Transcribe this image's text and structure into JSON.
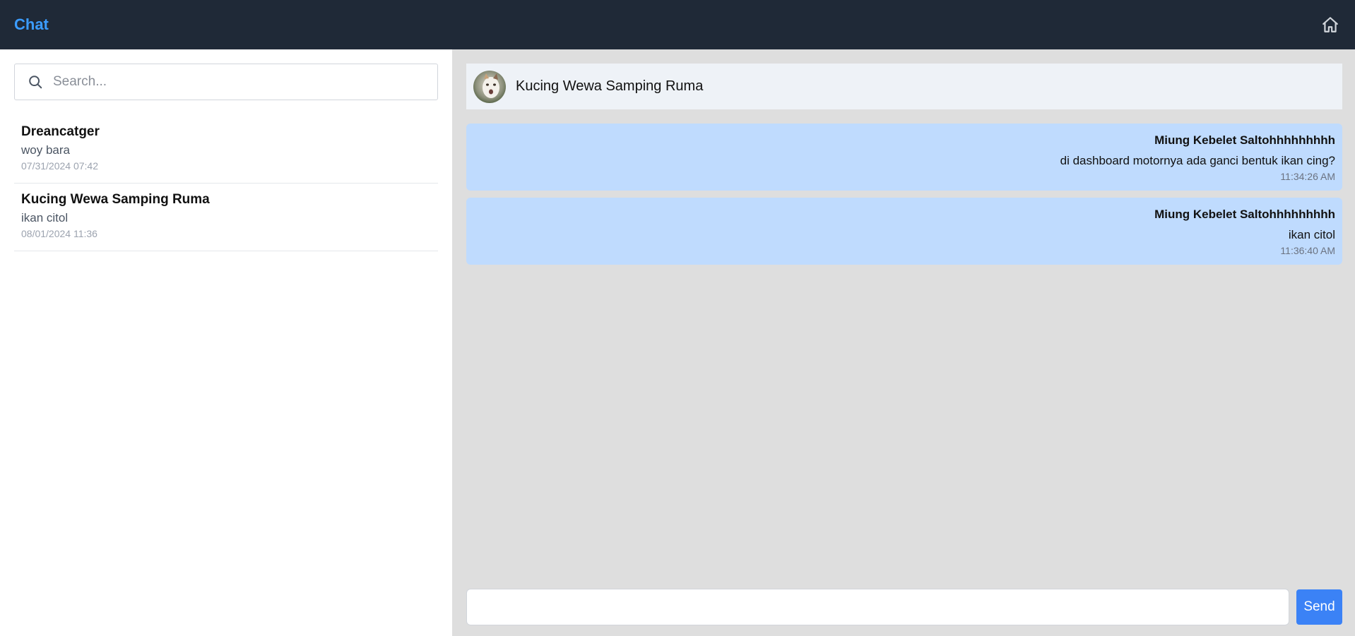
{
  "app": {
    "title": "Chat"
  },
  "icons": {
    "home": "home-icon",
    "search": "search-icon"
  },
  "search": {
    "placeholder": "Search..."
  },
  "conversations": [
    {
      "name": "Dreancatger",
      "last_message": "woy bara",
      "timestamp": "07/31/2024 07:42"
    },
    {
      "name": "Kucing Wewa Samping Ruma",
      "last_message": "ikan citol",
      "timestamp": "08/01/2024 11:36"
    }
  ],
  "chat": {
    "title": "Kucing Wewa Samping Ruma",
    "messages": [
      {
        "sender": "Miung Kebelet Saltohhhhhhhhh",
        "text": "di dashboard motornya ada ganci bentuk ikan cing?",
        "time": "11:34:26 AM"
      },
      {
        "sender": "Miung Kebelet Saltohhhhhhhhh",
        "text": "ikan citol",
        "time": "11:36:40 AM"
      }
    ]
  },
  "composer": {
    "value": "",
    "send_label": "Send"
  },
  "colors": {
    "topbar": "#1f2937",
    "brand": "#3b9cff",
    "bubble": "#bfdbfe",
    "send": "#3b82f6",
    "chat_bg": "#dedede"
  }
}
